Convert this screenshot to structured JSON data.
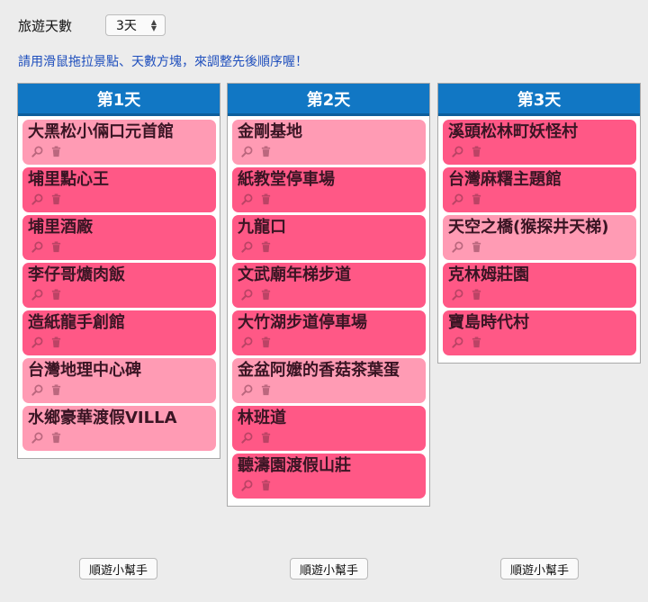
{
  "header": {
    "days_label": "旅遊天數",
    "days_value": "3天",
    "hint": "請用滑鼠拖拉景點、天數方塊，來調整先後順序喔！"
  },
  "columns": [
    {
      "title": "第1天",
      "helper_label": "順遊小幫手",
      "items": [
        {
          "name": "大黑松小倆口元首館",
          "tone": "light"
        },
        {
          "name": "埔里點心王",
          "tone": "dark"
        },
        {
          "name": "埔里酒廠",
          "tone": "dark"
        },
        {
          "name": "李仔哥爌肉飯",
          "tone": "dark"
        },
        {
          "name": "造紙龍手創館",
          "tone": "dark"
        },
        {
          "name": "台灣地理中心碑",
          "tone": "light"
        },
        {
          "name": "水鄉豪華渡假VILLA",
          "tone": "light"
        }
      ]
    },
    {
      "title": "第2天",
      "helper_label": "順遊小幫手",
      "items": [
        {
          "name": "金剛基地",
          "tone": "light"
        },
        {
          "name": "紙教堂停車場",
          "tone": "dark"
        },
        {
          "name": "九龍口",
          "tone": "dark"
        },
        {
          "name": "文武廟年梯步道",
          "tone": "dark"
        },
        {
          "name": "大竹湖步道停車場",
          "tone": "dark"
        },
        {
          "name": "金盆阿嬤的香菇茶葉蛋",
          "tone": "light"
        },
        {
          "name": "林班道",
          "tone": "dark"
        },
        {
          "name": "聽濤園渡假山莊",
          "tone": "dark"
        }
      ]
    },
    {
      "title": "第3天",
      "helper_label": "順遊小幫手",
      "items": [
        {
          "name": "溪頭松林町妖怪村",
          "tone": "dark"
        },
        {
          "name": "台灣麻糬主題館",
          "tone": "dark"
        },
        {
          "name": "天空之橋(猴探井天梯)",
          "tone": "light"
        },
        {
          "name": "克林姆莊園",
          "tone": "dark"
        },
        {
          "name": "寶島時代村",
          "tone": "dark"
        }
      ]
    }
  ],
  "icons": {
    "view": "magnifier-icon",
    "delete": "trash-icon"
  },
  "colors": {
    "header_blue": "#1177c4",
    "card_light": "#ff9bb4",
    "card_dark": "#ff5886",
    "hint_blue": "#1f4fbd"
  }
}
